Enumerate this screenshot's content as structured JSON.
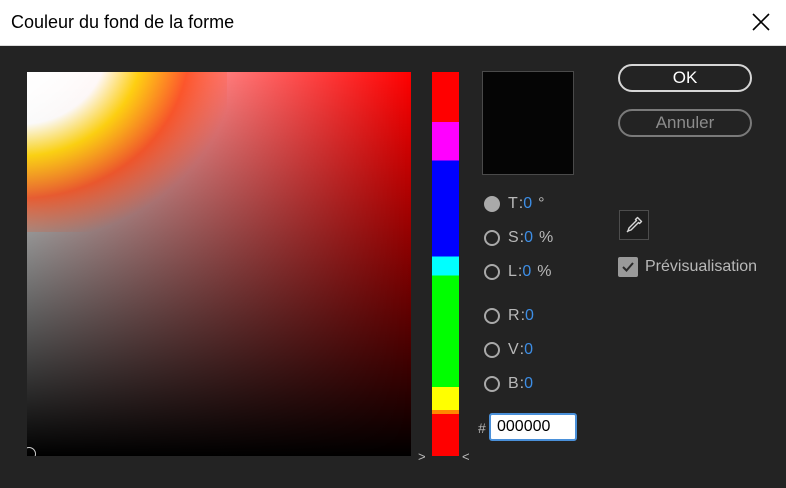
{
  "window": {
    "title": "Couleur du fond de la forme"
  },
  "color": {
    "swatch": "#050505",
    "field_hue": "#ff0000"
  },
  "channels": [
    {
      "label": "T",
      "value": "0",
      "unit": "°",
      "selected": true
    },
    {
      "label": "S",
      "value": "0",
      "unit": "%",
      "selected": false
    },
    {
      "label": "L",
      "value": "0",
      "unit": "%",
      "selected": false
    },
    {
      "label": "R",
      "value": "0",
      "unit": "",
      "selected": false
    },
    {
      "label": "V",
      "value": "0",
      "unit": "",
      "selected": false
    },
    {
      "label": "B",
      "value": "0",
      "unit": "",
      "selected": false
    }
  ],
  "hex": {
    "prefix": "#",
    "value": "000000"
  },
  "buttons": {
    "ok": "OK",
    "cancel": "Annuler"
  },
  "preview": {
    "label": "Prévisualisation",
    "checked": true
  },
  "icons": {
    "close": "close-icon",
    "eyedropper": "eyedropper-icon",
    "checkmark": "checkmark-icon"
  }
}
